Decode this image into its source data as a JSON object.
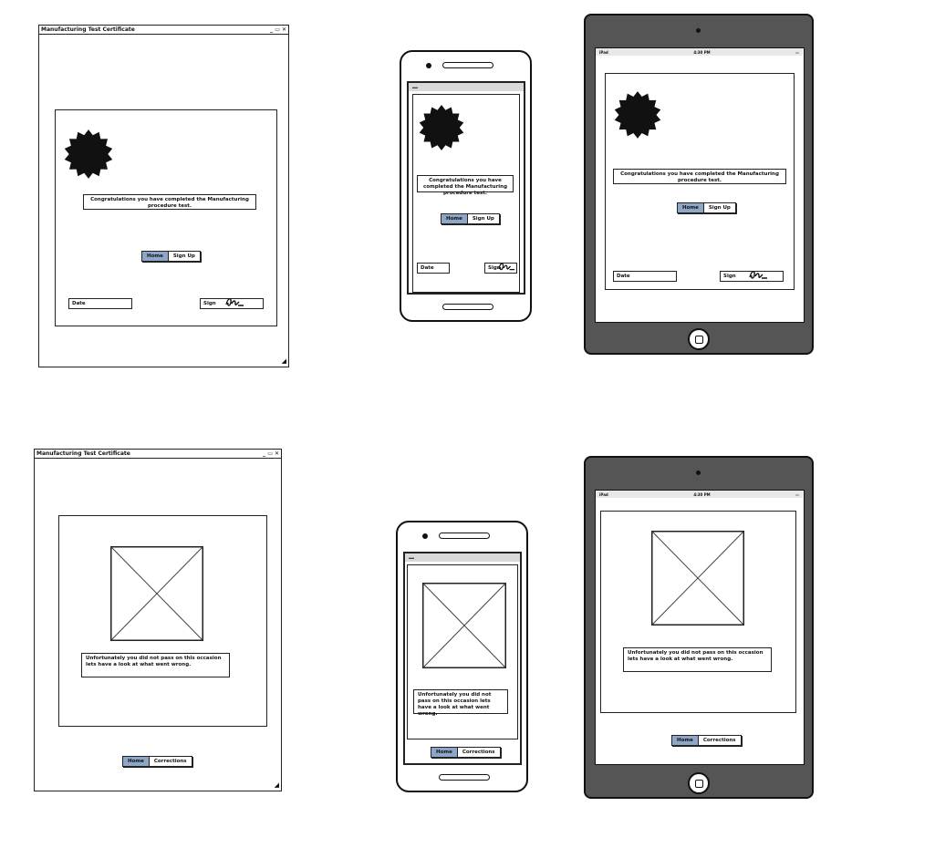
{
  "window": {
    "title": "Manufacturing Test Certificate",
    "controls": "_ ▭ ✕"
  },
  "success": {
    "message_desktop": "Congratulations you have completed the Manufacturing procedure test.",
    "message_phone": "Congratulations you have completed the Manufacturing procedure test.",
    "nav": {
      "home": "Home",
      "signup": "Sign Up"
    },
    "date_label": "Date",
    "sign_label": "Sign"
  },
  "failure": {
    "message": "Unfortunately you did not pass on this occasion lets have a look at what went wrong.",
    "nav": {
      "home": "Home",
      "corrections": "Corrections"
    }
  },
  "tablet_status": {
    "carrier": "iPad",
    "time": "4:30 PM"
  },
  "icons": {
    "badge": "starburst-badge-icon",
    "placeholder": "image-placeholder-icon",
    "signature": "signature-scribble-icon",
    "resize": "resize-grip-icon"
  },
  "colors": {
    "selected_tab": "#8ea6c8",
    "tablet_frame": "#555555"
  }
}
